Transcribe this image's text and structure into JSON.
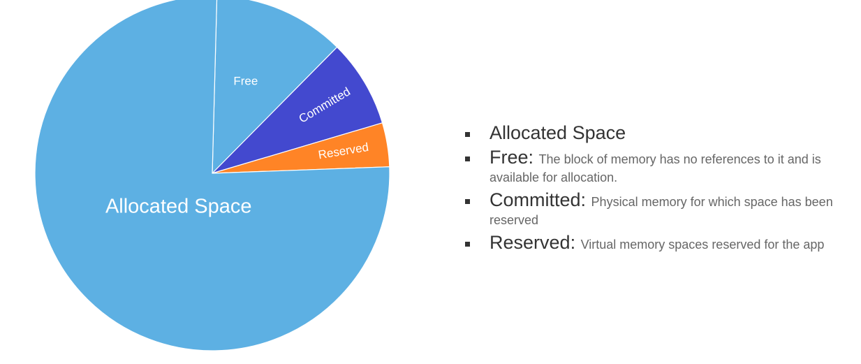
{
  "chart_data": {
    "type": "pie",
    "slices": [
      {
        "name": "Free",
        "value": 12.0,
        "color": "#5DB0E3"
      },
      {
        "name": "Committed",
        "value": 8.0,
        "color": "#4349CF"
      },
      {
        "name": "Reserved",
        "value": 4.0,
        "color": "#FF8426"
      },
      {
        "name": "Allocated Space",
        "value": 76.0,
        "color": "#5DB0E3"
      }
    ]
  },
  "legend": {
    "items": [
      {
        "term": "Allocated Space",
        "sep": "",
        "desc": ""
      },
      {
        "term": "Free",
        "sep": ": ",
        "desc": "The block of memory has no references to it and is available for allocation."
      },
      {
        "term": "Committed",
        "sep": ": ",
        "desc": "Physical memory for which space has been reserved"
      },
      {
        "term": "Reserved",
        "sep": ": ",
        "desc": "Virtual memory spaces reserved for the app"
      }
    ]
  }
}
